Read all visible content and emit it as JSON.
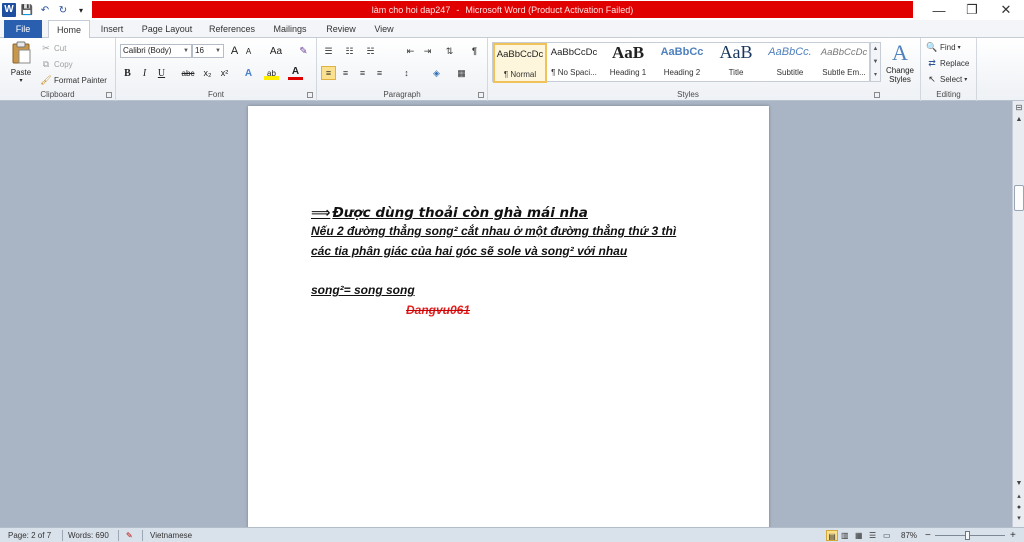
{
  "window": {
    "doc_name": "làm cho hoi dap247",
    "app_title": "Microsoft Word (Product Activation Failed)",
    "title_sep": "-",
    "minimize": "—",
    "restore": "❐",
    "close": "✕",
    "accent": "#e00000"
  },
  "qat": {
    "logo": "W",
    "save": "💾",
    "undo": "↶",
    "redo": "↻",
    "customize": "▾"
  },
  "tabs": [
    {
      "label": "File"
    },
    {
      "label": "Home"
    },
    {
      "label": "Insert"
    },
    {
      "label": "Page Layout"
    },
    {
      "label": "References"
    },
    {
      "label": "Mailings"
    },
    {
      "label": "Review"
    },
    {
      "label": "View"
    }
  ],
  "ribbon": {
    "clipboard": {
      "label": "Clipboard",
      "paste": "Paste",
      "cut": "Cut",
      "copy": "Copy",
      "format_painter": "Format Painter"
    },
    "font": {
      "label": "Font",
      "family": "Calibri (Body)",
      "size": "16",
      "grow": "A",
      "shrink": "A",
      "change_case": "Aa",
      "clear": "✎",
      "bold": "B",
      "italic": "I",
      "underline": "U",
      "strike": "abc",
      "subscript": "x₂",
      "superscript": "x²",
      "effects": "A",
      "highlight": "ab",
      "color": "A"
    },
    "paragraph": {
      "label": "Paragraph",
      "bullets": "☰",
      "numbering": "☷",
      "multilevel": "☵",
      "dec_indent": "⇤",
      "inc_indent": "⇥",
      "sort": "⇅",
      "show_marks": "¶",
      "align_left": "≡",
      "center": "≡",
      "align_right": "≡",
      "justify": "≡",
      "line_spacing": "↕",
      "shading": "◈",
      "borders": "▦"
    },
    "styles": {
      "label": "Styles",
      "items": [
        {
          "sample": "AaBbCcDc",
          "name": "¶ Normal"
        },
        {
          "sample": "AaBbCcDc",
          "name": "¶ No Spaci..."
        },
        {
          "sample": "AaB",
          "name": "Heading 1"
        },
        {
          "sample": "AaBbCc",
          "name": "Heading 2"
        },
        {
          "sample": "AaB",
          "name": "Title"
        },
        {
          "sample": "AaBbCc.",
          "name": "Subtitle"
        },
        {
          "sample": "AaBbCcDc",
          "name": "Subtle Em..."
        }
      ],
      "change_styles": "Change Styles",
      "change_styles_icon": "A"
    },
    "editing": {
      "label": "Editing",
      "find": "Find",
      "replace": "Replace",
      "select": "Select"
    }
  },
  "document": {
    "line1_arrow": "⟹",
    "line1": "Được dùng thoải còn ghà mái nha",
    "line2": "Nếu 2 đường thẳng song² cắt nhau ở một đường thẳng thứ 3 thì",
    "line3": "các tia phân giác của hai góc sẽ sole và song² với nhau",
    "line4": "song²= song song",
    "line5": "Dangvu061"
  },
  "status": {
    "page": "Page: 2 of 7",
    "words": "Words: 690",
    "language": "Vietnamese",
    "zoom": "87%",
    "zoom_minus": "−",
    "zoom_plus": "+"
  }
}
